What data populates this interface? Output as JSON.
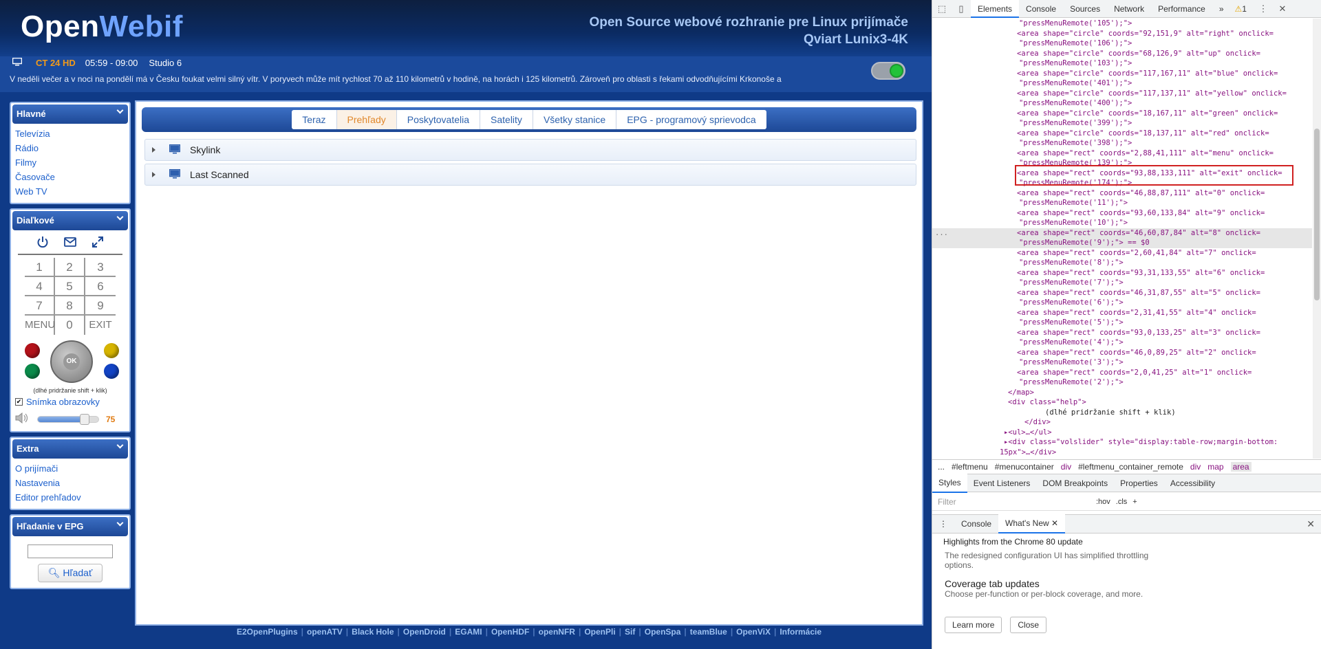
{
  "header": {
    "logo_part1": "Open",
    "logo_part2": "Webif",
    "tagline_line1": "Open Source webové rozhranie pre Linux prijímače",
    "tagline_line2": "Qviart Lunix3-4K"
  },
  "now": {
    "channel": "CT 24 HD",
    "time": "05:59 - 09:00",
    "program": "Studio 6",
    "description": "V neděli večer a v noci na pondělí má v Česku foukat velmi silný vítr. V poryvech může mít rychlost 70 až 110 kilometrů v hodině, na horách i 125 kilometrů. Zároveň pro oblasti s řekami odvodňujícími Krkonoše a"
  },
  "menu": {
    "main_title": "Hlavné",
    "main_items": [
      "Televízia",
      "Rádio",
      "Filmy",
      "Časovače",
      "Web TV"
    ],
    "remote_title": "Diaľkové",
    "keys": [
      "1",
      "2",
      "3",
      "4",
      "5",
      "6",
      "7",
      "8",
      "9",
      "MENU",
      "0",
      "EXIT"
    ],
    "ok_label": "OK",
    "help": "(dlhé pridržanie shift + klik)",
    "screenshot_label": "Snímka obrazovky",
    "volume_value": "75",
    "volume_level": 0.75,
    "extra_title": "Extra",
    "extra_items": [
      "O prijímači",
      "Nastavenia",
      "Editor prehľadov"
    ],
    "epg_title": "Hľadanie v EPG",
    "search_button": "Hľadať"
  },
  "content": {
    "tabs": [
      "Teraz",
      "Prehľady",
      "Poskytovatelia",
      "Satelity",
      "Všetky stanice",
      "EPG - programový sprievodca"
    ],
    "active_tab": "Prehľady",
    "bouquets": [
      "Skylink",
      "Last Scanned"
    ]
  },
  "footer": {
    "links": [
      "E2OpenPlugins",
      "openATV",
      "Black Hole",
      "OpenDroid",
      "EGAMI",
      "OpenHDF",
      "openNFR",
      "OpenPli",
      "Sif",
      "OpenSpa",
      "teamBlue",
      "OpenViX",
      "Informácie"
    ]
  },
  "devtools": {
    "tabs": [
      "Elements",
      "Console",
      "Sources",
      "Network",
      "Performance"
    ],
    "more": "»",
    "warnings": "1",
    "dom_lines": [
      "\"pressMenuRemote('105');\">",
      "<area shape=\"circle\" coords=\"92,151,9\" alt=\"right\" onclick=",
      "\"pressMenuRemote('106');\">",
      "<area shape=\"circle\" coords=\"68,126,9\" alt=\"up\" onclick=",
      "\"pressMenuRemote('103');\">",
      "<area shape=\"circle\" coords=\"117,167,11\" alt=\"blue\" onclick=",
      "\"pressMenuRemote('401');\">",
      "<area shape=\"circle\" coords=\"117,137,11\" alt=\"yellow\" onclick=",
      "\"pressMenuRemote('400');\">",
      "<area shape=\"circle\" coords=\"18,167,11\" alt=\"green\" onclick=",
      "\"pressMenuRemote('399');\">",
      "<area shape=\"circle\" coords=\"18,137,11\" alt=\"red\" onclick=",
      "\"pressMenuRemote('398');\">",
      "<area shape=\"rect\" coords=\"2,88,41,111\" alt=\"menu\" onclick=",
      "\"pressMenuRemote('139');\">",
      "<area shape=\"rect\" coords=\"93,88,133,111\" alt=\"exit\" onclick=",
      "\"pressMenuRemote('174');\">",
      "<area shape=\"rect\" coords=\"46,88,87,111\" alt=\"0\" onclick=",
      "\"pressMenuRemote('11');\">",
      "<area shape=\"rect\" coords=\"93,60,133,84\" alt=\"9\" onclick=",
      "\"pressMenuRemote('10');\">",
      "<area shape=\"rect\" coords=\"46,60,87,84\" alt=\"8\" onclick=",
      "\"pressMenuRemote('9');\"> == $0",
      "<area shape=\"rect\" coords=\"2,60,41,84\" alt=\"7\" onclick=",
      "\"pressMenuRemote('8');\">",
      "<area shape=\"rect\" coords=\"93,31,133,55\" alt=\"6\" onclick=",
      "\"pressMenuRemote('7');\">",
      "<area shape=\"rect\" coords=\"46,31,87,55\" alt=\"5\" onclick=",
      "\"pressMenuRemote('6');\">",
      "<area shape=\"rect\" coords=\"2,31,41,55\" alt=\"4\" onclick=",
      "\"pressMenuRemote('5');\">",
      "<area shape=\"rect\" coords=\"93,0,133,25\" alt=\"3\" onclick=",
      "\"pressMenuRemote('4');\">",
      "<area shape=\"rect\" coords=\"46,0,89,25\" alt=\"2\" onclick=",
      "\"pressMenuRemote('3');\">",
      "<area shape=\"rect\" coords=\"2,0,41,25\" alt=\"1\" onclick=",
      "\"pressMenuRemote('2');\">"
    ],
    "map_close": "</map>",
    "help_open": "<div class=\"help\">",
    "help_text": "(dlhé pridržanie shift + klik)",
    "div_close": "</div>",
    "ul_line": "▸<ul>…</ul>",
    "volslider_line1": "▸<div class=\"volslider\" style=\"display:table-row;margin-bottom:",
    "volslider_line2": "15px\">…</div>",
    "breadcrumbs": [
      "...",
      "#leftmenu",
      "#menucontainer",
      "div",
      "#leftmenu_container_remote",
      "div",
      "map",
      "area"
    ],
    "style_tabs": [
      "Styles",
      "Event Listeners",
      "DOM Breakpoints",
      "Properties",
      "Accessibility"
    ],
    "filter_placeholder": "Filter",
    "hov": ":hov",
    "cls": ".cls",
    "drawer_tabs": [
      "Console",
      "What's New"
    ],
    "whatsnew": {
      "highlights": "Highlights from the Chrome 80 update",
      "prev_text": "The redesigned configuration UI has simplified throttling options.",
      "heading": "Coverage tab updates",
      "body": "Choose per-function or per-block coverage, and more.",
      "learn_more": "Learn more",
      "close": "Close"
    }
  }
}
